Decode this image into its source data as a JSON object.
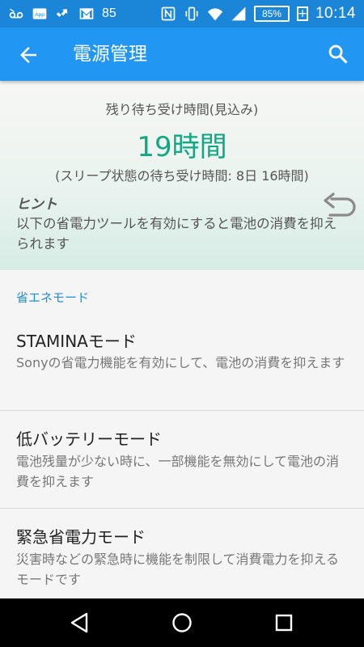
{
  "status_bar": {
    "left_icons": [
      "voicemail-icon",
      "app-icon",
      "usb-debug-icon",
      "gmail-icon"
    ],
    "temperature": "85",
    "right_icons": [
      "nfc-icon",
      "vibrate-icon",
      "wifi-icon",
      "signal-icon"
    ],
    "battery_percent": "85%",
    "charging_symbol": "+",
    "time": "10:14"
  },
  "app_bar": {
    "title": "電源管理",
    "back_icon": "arrow-left-icon",
    "search_icon": "search-icon"
  },
  "info": {
    "label": "残り待ち受け時間(見込み)",
    "hours": "19時間",
    "sleep_standby": "(スリープ状態の待ち受け時間: 8日 16時間)",
    "hint_title": "ヒント",
    "hint_text": "以下の省電力ツールを有効にすると電池の消費を抑えられます"
  },
  "section": {
    "header": "省エネモード",
    "items": [
      {
        "title": "STAMINAモード",
        "desc": "Sonyの省電力機能を有効にして、電池の消費を抑えます"
      },
      {
        "title": "低バッテリーモード",
        "desc": "電池残量が少ない時に、一部機能を無効にして電池の消費を抑えます"
      },
      {
        "title": "緊急省電力モード",
        "desc": "災害時などの緊急時に機能を制限して消費電力を抑えるモードです"
      }
    ]
  },
  "nav_bar": {
    "icons": [
      "back-triangle-icon",
      "home-circle-icon",
      "recents-square-icon"
    ]
  },
  "colors": {
    "status_bar": "#1b86d8",
    "app_bar": "#2196f3",
    "accent_green": "#0fa882",
    "section_header": "#1e8ed8"
  }
}
